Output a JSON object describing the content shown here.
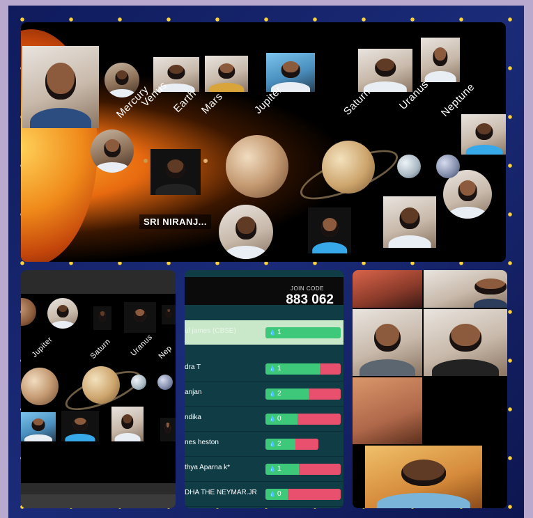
{
  "main": {
    "planets": [
      "Mercury",
      "Venus",
      "Earth",
      "Mars",
      "Jupiter",
      "Saturn",
      "Uranus",
      "Neptune"
    ],
    "participant_label": "SRI NIRANJ..."
  },
  "thumb": {
    "planets": [
      "Jupiter",
      "Saturn",
      "Uranus",
      "Nep"
    ]
  },
  "leaderboard": {
    "join_code_label": "JOIN CODE",
    "join_code": "883 062",
    "rows": [
      {
        "name": "ul james (CBSE)",
        "score": "1",
        "fill": 1.0
      },
      {
        "name": "dra T",
        "score": "1",
        "fill": 0.72
      },
      {
        "name": "anjan",
        "score": "2",
        "fill": 0.57
      },
      {
        "name": "ndika",
        "score": "0",
        "fill": 0.43
      },
      {
        "name": "nes heston",
        "score": "2",
        "fill": 0.57
      },
      {
        "name": "thya Aparna k*",
        "score": "1",
        "fill": 0.44
      },
      {
        "name": "DHA THE NEYMAR.JR",
        "score": "0",
        "fill": 0.3
      }
    ]
  },
  "colors": {
    "accent_green": "#3ec97a",
    "accent_red": "#e8506e"
  }
}
